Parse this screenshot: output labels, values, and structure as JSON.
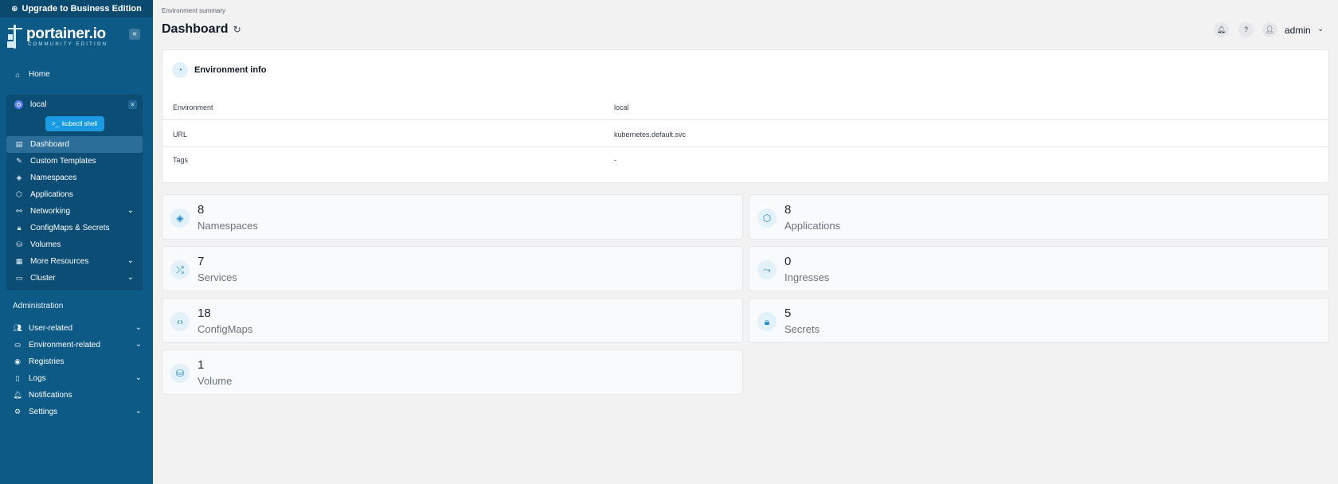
{
  "upgrade_label": "Upgrade to Business Edition",
  "brand": {
    "name": "portainer.io",
    "edition": "COMMUNITY EDITION"
  },
  "nav": {
    "home": "Home",
    "environment": {
      "name": "local",
      "kubectl": "kubectl shell",
      "items": [
        {
          "label": "Dashboard",
          "icon": "dashboard-icon"
        },
        {
          "label": "Custom Templates",
          "icon": "edit-icon"
        },
        {
          "label": "Namespaces",
          "icon": "layers-icon"
        },
        {
          "label": "Applications",
          "icon": "box-icon"
        },
        {
          "label": "Networking",
          "icon": "network-icon"
        },
        {
          "label": "ConfigMaps & Secrets",
          "icon": "lock-icon"
        },
        {
          "label": "Volumes",
          "icon": "database-icon"
        },
        {
          "label": "More Resources",
          "icon": "grid-icon"
        },
        {
          "label": "Cluster",
          "icon": "server-icon"
        }
      ]
    },
    "admin_label": "Administration",
    "admin_items": [
      {
        "label": "User-related",
        "icon": "users-icon"
      },
      {
        "label": "Environment-related",
        "icon": "hdd-icon"
      },
      {
        "label": "Registries",
        "icon": "radio-icon"
      },
      {
        "label": "Logs",
        "icon": "file-icon"
      },
      {
        "label": "Notifications",
        "icon": "bell-icon"
      },
      {
        "label": "Settings",
        "icon": "gear-icon"
      }
    ]
  },
  "header": {
    "breadcrumb": "Environment summary",
    "title": "Dashboard",
    "user": "admin"
  },
  "env_info": {
    "title": "Environment info",
    "rows": [
      {
        "key": "Environment",
        "value": "local"
      },
      {
        "key": "URL",
        "value": "kubernetes.default.svc"
      },
      {
        "key": "Tags",
        "value": "-"
      }
    ]
  },
  "stats": [
    {
      "count": "8",
      "label": "Namespaces",
      "icon": "layers-icon"
    },
    {
      "count": "8",
      "label": "Applications",
      "icon": "box-icon"
    },
    {
      "count": "7",
      "label": "Services",
      "icon": "shuffle-icon"
    },
    {
      "count": "0",
      "label": "Ingresses",
      "icon": "route-icon"
    },
    {
      "count": "18",
      "label": "ConfigMaps",
      "icon": "file-code-icon"
    },
    {
      "count": "5",
      "label": "Secrets",
      "icon": "lock-icon"
    },
    {
      "count": "1",
      "label": "Volume",
      "icon": "database-icon"
    }
  ]
}
